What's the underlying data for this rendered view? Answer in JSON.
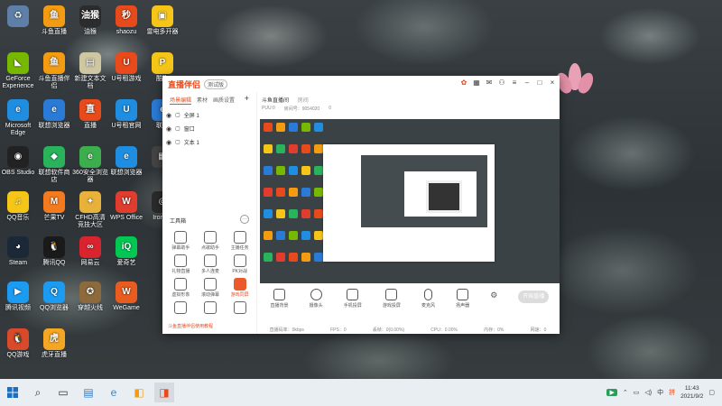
{
  "desktop": {
    "icons": [
      {
        "label": "",
        "color": "#5d7fa8",
        "glyph": "♻"
      },
      {
        "label": "斗鱼直播",
        "color": "#f39c12",
        "glyph": "鱼"
      },
      {
        "label": "油猴",
        "color": "#2c2c2c",
        "glyph": "油猴"
      },
      {
        "label": "shaozu",
        "color": "#e84a1b",
        "glyph": "秒"
      },
      {
        "label": "雷电多开器",
        "color": "#f5c518",
        "glyph": "▣"
      },
      {
        "label": "GeForce Experience",
        "color": "#76b900",
        "glyph": "◣"
      },
      {
        "label": "斗鱼直播伴侣",
        "color": "#f39c12",
        "glyph": "鱼"
      },
      {
        "label": "新建文本文档",
        "color": "#cfc7a2",
        "glyph": "▤"
      },
      {
        "label": "U号租游戏",
        "color": "#e84a1b",
        "glyph": "U"
      },
      {
        "label": "酷狗",
        "color": "#f5c518",
        "glyph": "P"
      },
      {
        "label": "Microsoft Edge",
        "color": "#1f8ee0",
        "glyph": "e"
      },
      {
        "label": "联想浏览器",
        "color": "#2a7bd6",
        "glyph": "e"
      },
      {
        "label": "直播",
        "color": "#e84a1b",
        "glyph": "直"
      },
      {
        "label": "U号租官网",
        "color": "#1f8ee0",
        "glyph": "U"
      },
      {
        "label": "联想",
        "color": "#2a7bd6",
        "glyph": "e"
      },
      {
        "label": "OBS Studio",
        "color": "#222",
        "glyph": "◉"
      },
      {
        "label": "联想软件商店",
        "color": "#29b35a",
        "glyph": "◆"
      },
      {
        "label": "360安全浏览器",
        "color": "#3cae4d",
        "glyph": "e"
      },
      {
        "label": "联想浏览器",
        "color": "#1f8ee0",
        "glyph": "e"
      },
      {
        "label": "",
        "color": "#444",
        "glyph": "▦"
      },
      {
        "label": "QQ音乐",
        "color": "#f5c518",
        "glyph": "♫"
      },
      {
        "label": "芒果TV",
        "color": "#f47a20",
        "glyph": "M"
      },
      {
        "label": "CFHD高清竞技大区",
        "color": "#e8b23a",
        "glyph": "✦"
      },
      {
        "label": "WPS Office",
        "color": "#e03d2e",
        "glyph": "W"
      },
      {
        "label": "Iron Cr",
        "color": "#2b2b2b",
        "glyph": "◎"
      },
      {
        "label": "Steam",
        "color": "#1b2838",
        "glyph": "◕"
      },
      {
        "label": "腾讯QQ",
        "color": "#1a1a1a",
        "glyph": "🐧"
      },
      {
        "label": "网易云",
        "color": "#d9232e",
        "glyph": "∞"
      },
      {
        "label": "爱奇艺",
        "color": "#00c853",
        "glyph": "iQ"
      },
      {
        "label": "U租",
        "color": "#e84a1b",
        "glyph": "U"
      },
      {
        "label": "腾讯视频",
        "color": "#1b9cf2",
        "glyph": "▶"
      },
      {
        "label": "QQ浏览器",
        "color": "#1b9cf2",
        "glyph": "Q"
      },
      {
        "label": "穿越火线",
        "color": "#8c6a3c",
        "glyph": "✪"
      },
      {
        "label": "WeGame",
        "color": "#e85d1f",
        "glyph": "W"
      },
      {
        "label": "微信",
        "color": "#2aae67",
        "glyph": "✉"
      },
      {
        "label": "QQ游戏",
        "color": "#d94a2a",
        "glyph": "🐧"
      },
      {
        "label": "虎牙直播",
        "color": "#f5a623",
        "glyph": "虎"
      }
    ]
  },
  "window": {
    "app_name": "直播伴侣",
    "version": "测试版",
    "titlebar_icons": [
      "gift-icon",
      "grid-icon",
      "mail-icon",
      "shirt-icon",
      "menu-icon",
      "minimize-icon",
      "maximize-icon",
      "close-icon"
    ],
    "left": {
      "tabs": [
        "场景编辑",
        "素材",
        "画质设置"
      ],
      "scenes": [
        "全屏 1",
        "窗口",
        "文本 1"
      ],
      "tools_title": "工具箱",
      "tools": [
        {
          "label": "弹幕助手",
          "hl": false
        },
        {
          "label": "点歌助手",
          "hl": false
        },
        {
          "label": "主播任务",
          "hl": false
        },
        {
          "label": "礼物直播",
          "hl": false
        },
        {
          "label": "多人连麦",
          "hl": false
        },
        {
          "label": "PK对战",
          "hl": false
        },
        {
          "label": "虚拟形象",
          "hl": false
        },
        {
          "label": "滚动弹幕",
          "hl": false
        },
        {
          "label": "游戏同屏",
          "hl": true
        },
        {
          "label": "",
          "hl": false
        },
        {
          "label": "",
          "hl": false
        },
        {
          "label": "",
          "hl": false
        }
      ],
      "notice": "斗鱼直播伴侣使用教程"
    },
    "right": {
      "title": "斗鱼直播间",
      "subtitle": "房间",
      "room_id": "9054020",
      "stats": [
        "PUU:0",
        "房间号：9054020",
        "0"
      ],
      "controls": [
        "直播背景",
        "摄像头",
        "手机投屏",
        "游戏投屏",
        "麦克风",
        "扬声器"
      ],
      "go_live": "开始直播",
      "status": [
        "直播码率：0kbps",
        "FPS：0",
        "丢帧：0(0.00%)",
        "CPU：0.00%",
        "内存：0%",
        "网速：0"
      ]
    }
  },
  "taskbar": {
    "search_glyph": "⌕",
    "time": "11:43",
    "date": "2021/9/2",
    "tray_label": "中",
    "ime": "拼"
  }
}
